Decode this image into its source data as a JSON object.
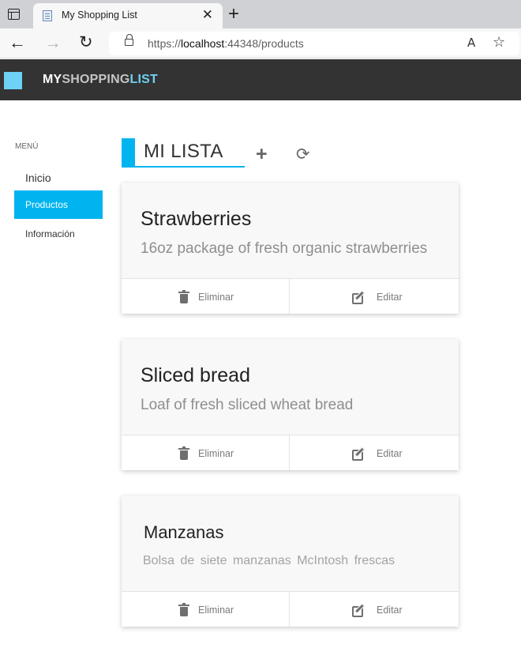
{
  "browser": {
    "tab_title": "My Shopping List",
    "tab_close": "✕",
    "new_tab": "+",
    "url_scheme": "https://",
    "url_host": "localhost",
    "url_rest": ":44348/products",
    "nav_back": "←",
    "nav_forward": "→",
    "nav_reload": "↻",
    "read_aloud": "A",
    "favorites": "☆"
  },
  "header": {
    "brand_part1": "MY",
    "brand_part2": "SHOPPING",
    "brand_part3": "LIST"
  },
  "sidebar": {
    "menu_label": "MENÚ",
    "items": [
      {
        "label": "Inicio",
        "active": false
      },
      {
        "label": "Productos",
        "active": true
      },
      {
        "label": "Información",
        "active": false
      }
    ]
  },
  "main": {
    "title": "MI LISTA",
    "add_label": "+",
    "refresh_label": "⟳",
    "delete_label": "Eliminar",
    "edit_label": "Editar",
    "products": [
      {
        "name": "Strawberries",
        "description": "16oz package of fresh organic strawberries"
      },
      {
        "name": "Sliced bread",
        "description": "Loaf of fresh sliced wheat bread"
      },
      {
        "name": "Manzanas",
        "description": "Bolsa de siete manzanas McIntosh frescas"
      }
    ]
  },
  "colors": {
    "accent": "#00b4f0",
    "header_bg": "#333333",
    "brand_accent": "#6ed1f5"
  }
}
